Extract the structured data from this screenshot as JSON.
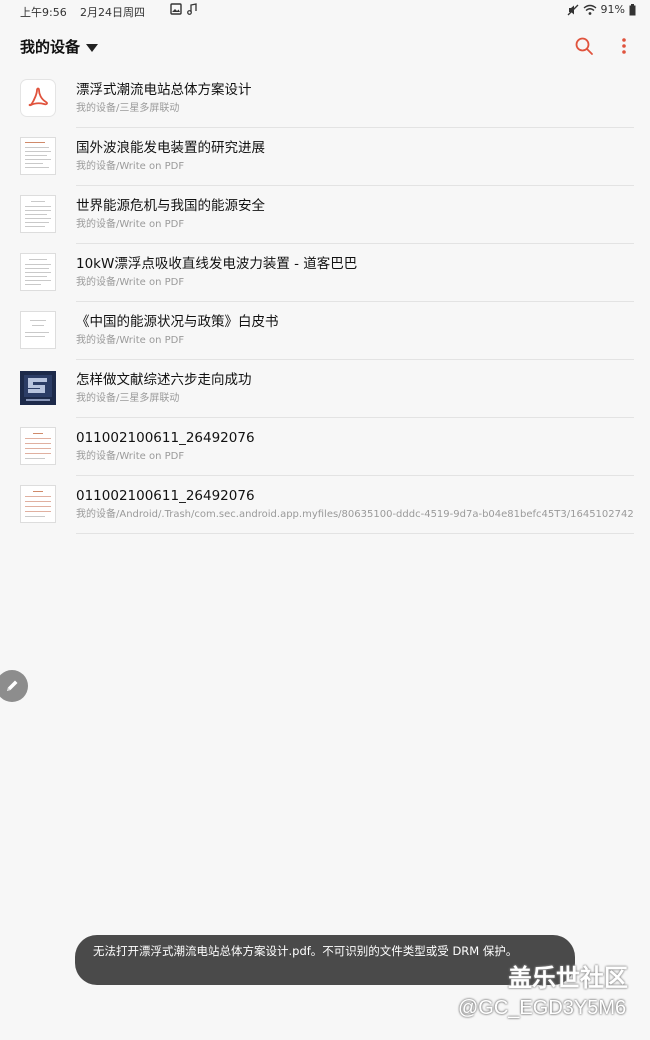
{
  "status_bar": {
    "time": "上午9:56",
    "date": "2月24日周四",
    "battery": "91%"
  },
  "header": {
    "title": "我的设备"
  },
  "files": [
    {
      "name": "漂浮式潮流电站总体方案设计",
      "path": "我的设备/三星多屏联动",
      "thumb": "pdf-icon"
    },
    {
      "name": "国外波浪能发电装置的研究进展",
      "path": "我的设备/Write on PDF",
      "thumb": "document-thumbnail"
    },
    {
      "name": "世界能源危机与我国的能源安全",
      "path": "我的设备/Write on PDF",
      "thumb": "document-thumbnail"
    },
    {
      "name": "10kW漂浮点吸收直线发电波力装置 - 道客巴巴",
      "path": "我的设备/Write on PDF",
      "thumb": "document-thumbnail"
    },
    {
      "name": "《中国的能源状况与政策》白皮书",
      "path": "我的设备/Write on PDF",
      "thumb": "document-thumbnail"
    },
    {
      "name": "怎样做文献综述六步走向成功",
      "path": "我的设备/三星多屏联动",
      "thumb": "dark-thumbnail"
    },
    {
      "name": "011002100611_26492076",
      "path": "我的设备/Write on PDF",
      "thumb": "invoice-thumbnail"
    },
    {
      "name": "011002100611_26492076",
      "path": "我的设备/Android/.Trash/com.sec.android.app.myfiles/80635100-dddc-4519-9d7a-b04e81befc45T3/16451027427…",
      "thumb": "invoice-thumbnail"
    }
  ],
  "toast": {
    "message": "无法打开漂浮式潮流电站总体方案设计.pdf。不可识别的文件类型或受 DRM 保护。"
  },
  "watermark": {
    "site": "盖乐世社区",
    "user": "@GC_EGD3Y5M6"
  },
  "colors": {
    "accent": "#e0533d",
    "background": "#f7f7f7",
    "toast": "#4a4a4a"
  }
}
